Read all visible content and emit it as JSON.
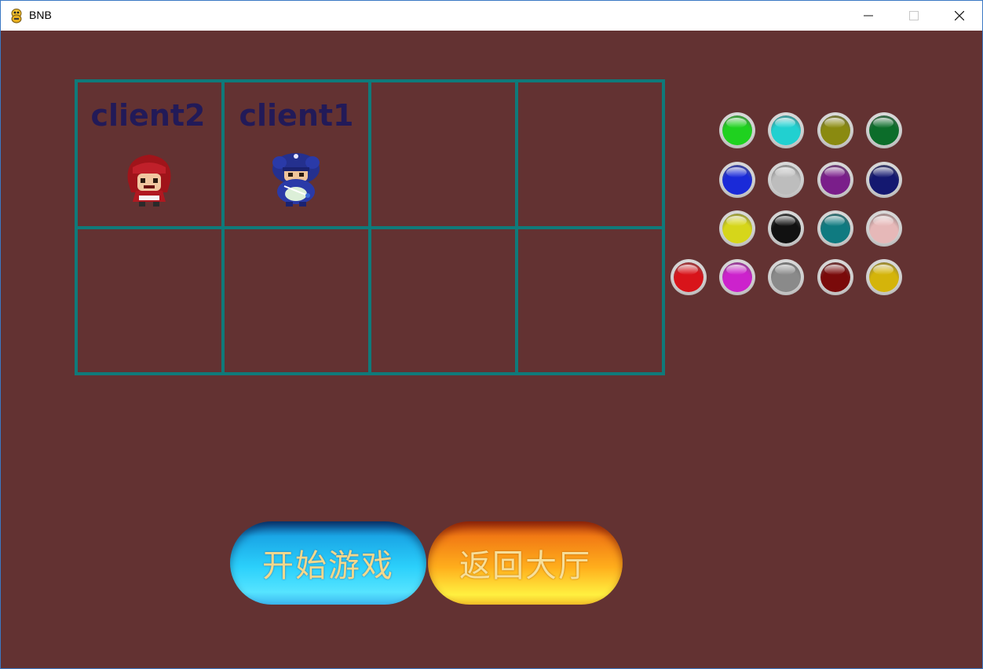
{
  "window": {
    "title": "BNB",
    "app_icon": "python-snake-icon"
  },
  "title_controls": {
    "minimize": "minimize-icon",
    "maximize": "maximize-icon",
    "close": "close-icon"
  },
  "colors": {
    "background": "#633232",
    "grid_line": "#0f7a7a",
    "player_name": "#221a58"
  },
  "slots": [
    {
      "name": "client2",
      "character": "red-hair-girl"
    },
    {
      "name": "client1",
      "character": "blue-ninja"
    },
    {
      "name": "",
      "character": ""
    },
    {
      "name": "",
      "character": ""
    },
    {
      "name": "",
      "character": ""
    },
    {
      "name": "",
      "character": ""
    },
    {
      "name": "",
      "character": ""
    },
    {
      "name": "",
      "character": ""
    }
  ],
  "color_palette": [
    [
      "#1fd11f",
      "#21d0d0",
      "#8a8a10",
      "#0c6d2a"
    ],
    [
      "#1a2ad8",
      "#bdbdbd",
      "#7a1e8a",
      "#141870"
    ],
    [
      "#d6d61a",
      "#111111",
      "#0f7a80",
      "#e6b8b8"
    ],
    [
      "#d8141a",
      "#cc22cc",
      "#8a8a8a",
      "#7a0a0a",
      "#d4b40a"
    ]
  ],
  "buttons": {
    "start_game": "开始游戏",
    "back_to_lobby": "返回大厅"
  }
}
